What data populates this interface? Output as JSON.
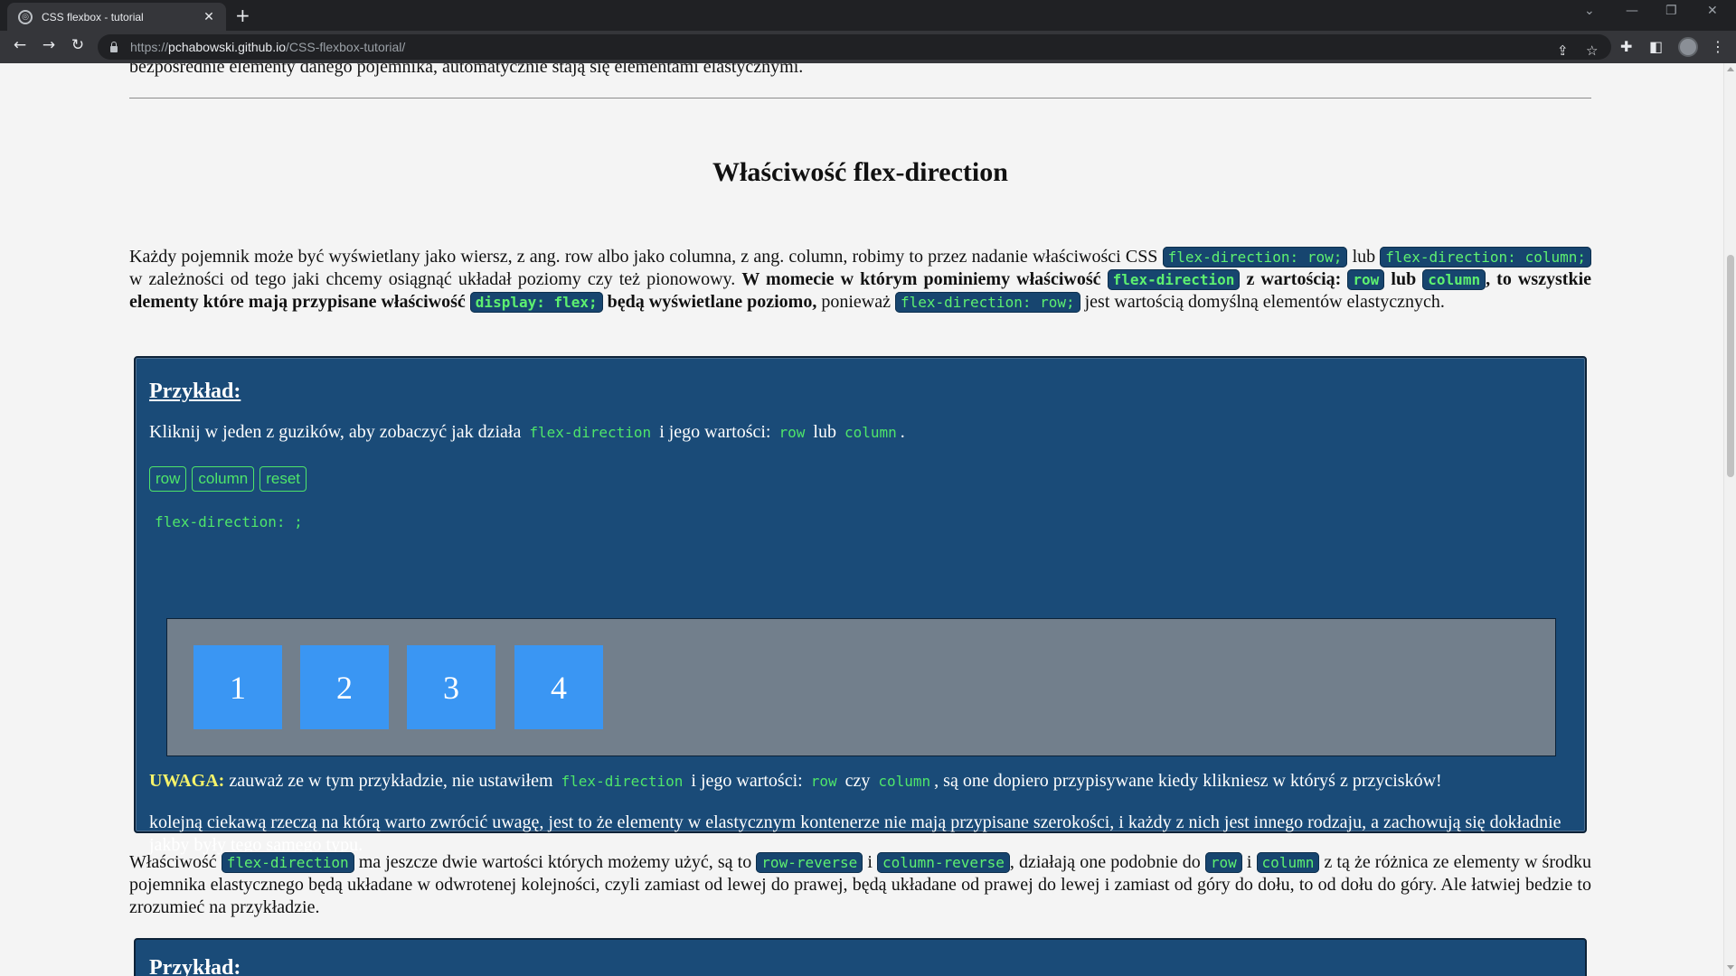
{
  "browser": {
    "tab_title": "CSS flexbox - tutorial",
    "url_prefix": "https://",
    "url_host": "pchabowski.github.io",
    "url_path": "/CSS-flexbox-tutorial/"
  },
  "page": {
    "prev_text": "bezpośrednie elementy danego pojemnika, automatycznie stają się elementami elastycznymi.",
    "section_title": "Właściwość flex-direction",
    "intro": {
      "t1": "Każdy pojemnik może być wyświetlany jako wiersz, z ang. row albo jako columna, z ang. column, robimy to przez nadanie właściwości CSS ",
      "c1": "flex-direction: row;",
      "t2": " lub ",
      "c2": "flex-direction: column;",
      "t3": " w zależności od tego jaki chcemy osiągnąć układał poziomy czy też pionowowy. ",
      "b1": "W momecie w którym pominiemy właściwość ",
      "c3": "flex-direction",
      "b2": " z wartością: ",
      "c4": "row",
      "b3": " lub ",
      "c5": "column",
      "b4": ", to wszystkie elementy które mają przypisane właściwość ",
      "c6": "display: flex;",
      "b5": " będą wyświetlane poziomo,",
      "t4": " ponieważ ",
      "c7": "flex-direction: row;",
      "t5": " jest wartością domyślną elementów elastycznych."
    },
    "example": {
      "title": "Przykład:",
      "instr_t1": "Kliknij w jeden z guzików, aby zobaczyć jak działa",
      "instr_c1": "flex-direction",
      "instr_t2": "i jego wartości:",
      "instr_c2": "row",
      "instr_t3": "lub",
      "instr_c3": "column",
      "instr_t4": ".",
      "buttons": [
        "row",
        "column",
        "reset"
      ],
      "code_line": "flex-direction: ;",
      "items": [
        "1",
        "2",
        "3",
        "4"
      ],
      "warn_label": "UWAGA:",
      "warn_t1": " zauważ ze w tym przykładzie, nie ustawiłem",
      "warn_c1": "flex-direction",
      "warn_t2": "i jego wartości:",
      "warn_c2": "row",
      "warn_t3": "czy",
      "warn_c3": "column",
      "warn_t4": ", są one dopiero przypisywane kiedy klikniesz w któryś z przycisków!",
      "note": "kolejną ciekawą rzeczą na którą warto zwrócić uwagę, jest to że elementy w elastycznym kontenerze nie mają przypisane szerokości, i każdy z nich jest innego rodzaju, a zachowują się dokładnie jakby były tego samego typu."
    },
    "outro": {
      "t1": "Właściwość ",
      "c1": "flex-direction",
      "t2": " ma jeszcze dwie wartości których możemy użyć, są to ",
      "c2": "row-reverse",
      "t3": " i ",
      "c3": "column-reverse",
      "t4": ", działają one podobnie do ",
      "c4": "row",
      "t5": " i ",
      "c5": "column",
      "t6": " z tą że różnica ze elementy w środku pojemnika elastycznego będą układane w odwrotenej kolejności, czyli zamiast od lewej do prawej, będą układane od prawej do lewej i zamiast od góry do dołu, to od dołu do góry. Ale łatwiej bedzie to zrozumieć na przykładzie."
    },
    "example2_title": "Przykład:"
  },
  "colors": {
    "example_bg": "#1a4b78",
    "code_green": "#4ee56a",
    "flex_item": "#3a96f3",
    "flex_container": "#727f8c",
    "warn_yellow": "#f5f36a"
  },
  "icons": [
    "globe-icon",
    "close-icon",
    "plus-icon",
    "back-arrow-icon",
    "forward-arrow-icon",
    "reload-icon",
    "lock-icon",
    "share-icon",
    "star-icon",
    "extensions-icon",
    "sidepanel-icon",
    "menu-dots-icon"
  ]
}
